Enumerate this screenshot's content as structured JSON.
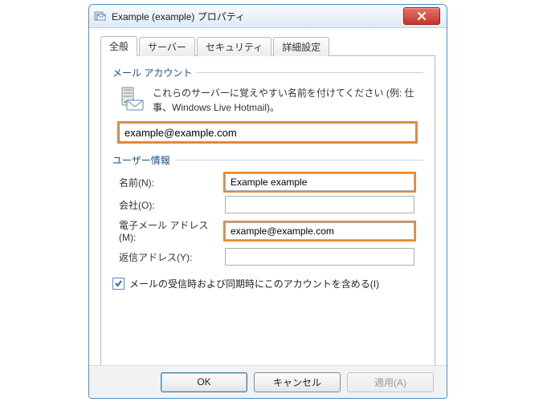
{
  "window": {
    "title": "Example (example) プロパティ"
  },
  "tabs": {
    "general": "全般",
    "server": "サーバー",
    "security": "セキュリティ",
    "advanced": "詳細設定"
  },
  "mail_account": {
    "group_label": "メール アカウント",
    "description": "これらのサーバーに覚えやすい名前を付けてください (例: 仕事、Windows Live Hotmail)。",
    "account_name": "example@example.com"
  },
  "user_info": {
    "group_label": "ユーザー情報",
    "name_label": "名前(N):",
    "name_value": "Example example",
    "company_label": "会社(O):",
    "company_value": "",
    "email_label": "電子メール アドレス(M):",
    "email_value": "example@example.com",
    "reply_label": "返信アドレス(Y):",
    "reply_value": ""
  },
  "include_checkbox": {
    "label": "メールの受信時および同期時にこのアカウントを含める(I)",
    "checked": true
  },
  "buttons": {
    "ok": "OK",
    "cancel": "キャンセル",
    "apply": "適用(A)"
  }
}
